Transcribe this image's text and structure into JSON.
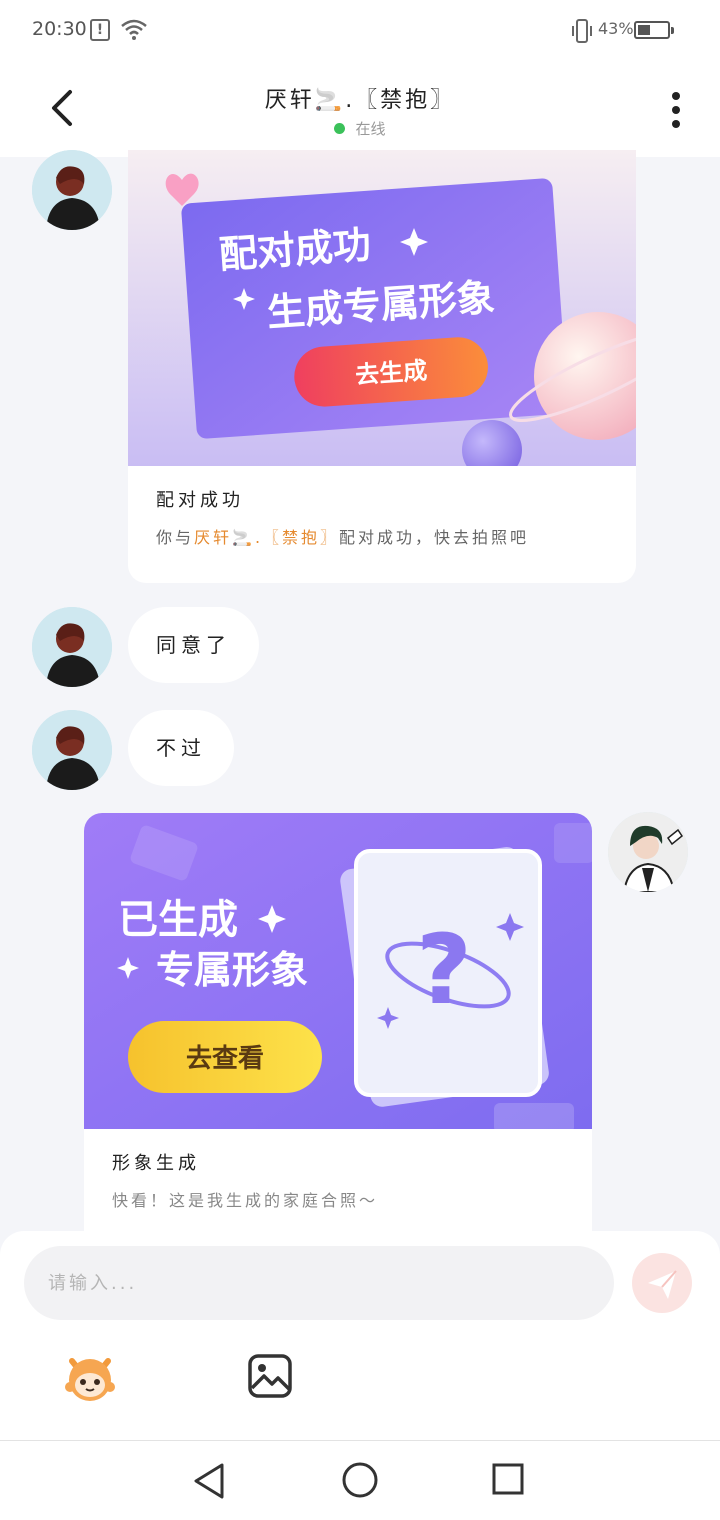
{
  "status_bar": {
    "time": "20:30",
    "battery": "43%",
    "battery_level": 0.43
  },
  "header": {
    "title": "厌轩🚬.〖禁抱〗",
    "status": "在线",
    "status_color": "#3bc15a"
  },
  "messages": [
    {
      "type": "card",
      "side": "left",
      "banner": {
        "headline": "配对成功",
        "subline": "生成专属形象",
        "button": "去生成"
      },
      "title": "配对成功",
      "desc_pre": "你与",
      "desc_name": "厌轩🚬.〖禁抱〗",
      "desc_post": "配对成功，快去拍照吧"
    },
    {
      "type": "text",
      "side": "left",
      "text": "同意了"
    },
    {
      "type": "text",
      "side": "left",
      "text": "不过"
    },
    {
      "type": "card",
      "side": "right",
      "banner": {
        "headline": "已生成",
        "subline": "专属形象",
        "button": "去查看"
      },
      "title": "形象生成",
      "desc": "快看！这是我生成的家庭合照～"
    }
  ],
  "input": {
    "placeholder": "请输入..."
  },
  "icons": {
    "back": "chevron-left-icon",
    "more": "more-vertical-icon",
    "send": "paper-plane-icon",
    "emoji": "emoji-face-icon",
    "image": "image-icon"
  },
  "colors": {
    "accent_orange": "#e58a2f",
    "online_green": "#3bc15a",
    "purple": "#8b6cf5"
  }
}
